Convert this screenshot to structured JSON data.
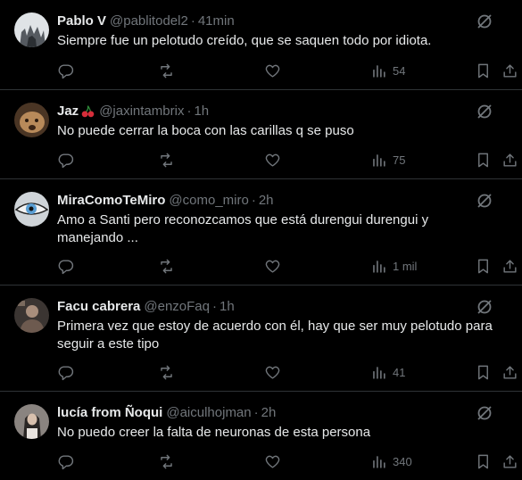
{
  "tweets": [
    {
      "name": "Pablo V",
      "handle": "@pablitodel2",
      "time": "41min",
      "text": "Siempre fue un pelotudo creído, que se saquen todo por idiota.",
      "views": "54"
    },
    {
      "name": "Jaz",
      "handle": "@jaxintambrix",
      "time": "1h",
      "text": "No puede cerrar la boca con las carillas q se puso",
      "views": "75"
    },
    {
      "name": "MiraComoTeMiro",
      "handle": "@como_miro",
      "time": "2h",
      "text": "Amo a Santi pero reconozcamos que está durengui durengui y manejando ...",
      "views": "1 mil"
    },
    {
      "name": "Facu cabrera",
      "handle": "@enzoFaq",
      "time": "1h",
      "text": "Primera vez que estoy de acuerdo con él, hay que ser muy pelotudo para seguir a este tipo",
      "views": "41"
    },
    {
      "name": "lucía from Ñoqui",
      "handle": "@aiculhojman",
      "time": "2h",
      "text": "No puedo creer la falta de neuronas de esta persona",
      "views": "340"
    }
  ],
  "separator": "·",
  "colors": {
    "background": "#000000",
    "text": "#e7e9ea",
    "muted": "#71767b",
    "divider": "#2f3336"
  }
}
